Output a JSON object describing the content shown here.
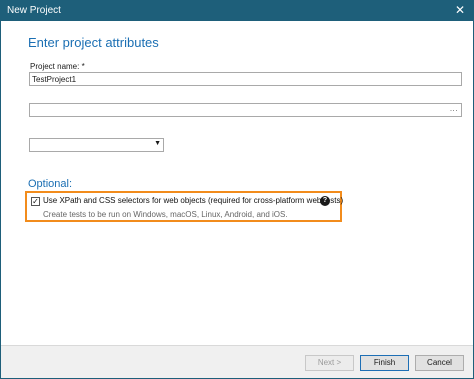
{
  "window": {
    "title": "New Project",
    "close_glyph": "✕"
  },
  "page": {
    "heading": "Enter project attributes",
    "project_name_label": "Project name: *",
    "project_name_value": "TestProject1",
    "path_value": "",
    "browse_label": "...",
    "dropdown_value": "",
    "optional_heading": "Optional:"
  },
  "option": {
    "checked": true,
    "check_glyph": "✓",
    "label": "Use XPath and CSS selectors for web objects (required for cross-platform web tests)",
    "help_glyph": "?",
    "description": "Create tests to be run on Windows, macOS, Linux, Android, and iOS."
  },
  "buttons": {
    "next": "Next >",
    "finish": "Finish",
    "cancel": "Cancel"
  },
  "colors": {
    "titlebar": "#1e5f7a",
    "heading": "#1b6fb3",
    "highlight": "#f28c1c"
  }
}
